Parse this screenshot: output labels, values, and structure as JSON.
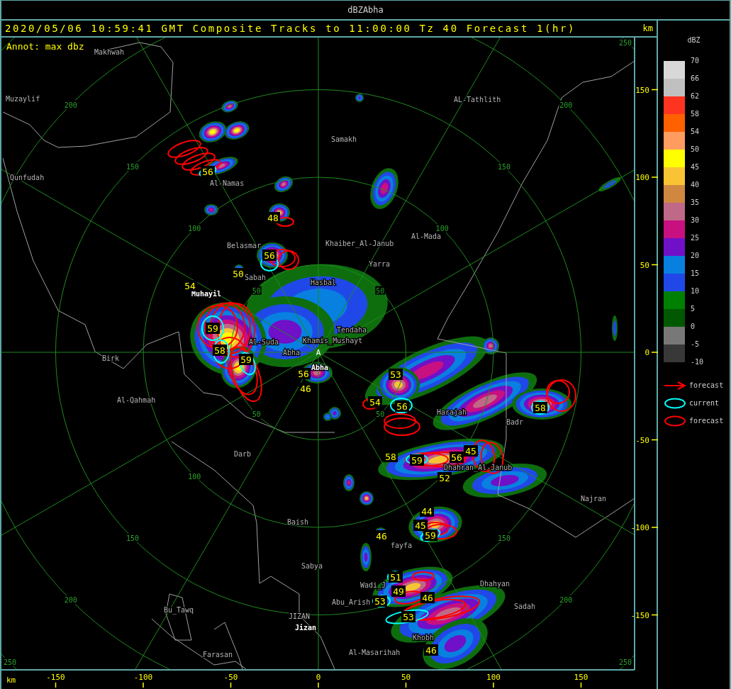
{
  "window": {
    "title": "dBZAbha"
  },
  "header": {
    "title": "2020/05/06 10:59:41 GMT Composite Tracks to 11:00:00 Tz 40 Forecast 1(hr)",
    "units": "km",
    "annotation": "Annot: max dbz"
  },
  "map": {
    "radar_marker": "A",
    "places": [
      {
        "name": "Makhwah",
        "kind": "plain"
      },
      {
        "name": "Muzaylif",
        "kind": "plain"
      },
      {
        "name": "AL-Tathlith",
        "kind": "plain"
      },
      {
        "name": "Samakh",
        "kind": "plain"
      },
      {
        "name": "Qunfudah",
        "kind": "plain"
      },
      {
        "name": "Al-Namas",
        "kind": "plain"
      },
      {
        "name": "Al-Mada",
        "kind": "plain"
      },
      {
        "name": "Belasmar",
        "kind": "plain"
      },
      {
        "name": "Khaiber_Al-Janub",
        "kind": "plain"
      },
      {
        "name": "Yarra",
        "kind": "plain"
      },
      {
        "name": "Sabah",
        "kind": "plain"
      },
      {
        "name": "Hasbal",
        "kind": "plain"
      },
      {
        "name": "Muhayil",
        "kind": "bright"
      },
      {
        "name": "Tendaha",
        "kind": "plain"
      },
      {
        "name": "Al-Suda",
        "kind": "plain"
      },
      {
        "name": "Khamis_Mushayt",
        "kind": "plain"
      },
      {
        "name": "Birk",
        "kind": "plain"
      },
      {
        "name": "Abha",
        "kind": "plain"
      },
      {
        "name": "Abha",
        "kind": "bright"
      },
      {
        "name": "Al-Qahmah",
        "kind": "plain"
      },
      {
        "name": "Harajah",
        "kind": "plain"
      },
      {
        "name": "Badr",
        "kind": "plain"
      },
      {
        "name": "Darb",
        "kind": "plain"
      },
      {
        "name": "Dhahran_Al-Janub",
        "kind": "plain"
      },
      {
        "name": "Najran",
        "kind": "plain"
      },
      {
        "name": "Baish",
        "kind": "plain"
      },
      {
        "name": "fayfa",
        "kind": "plain"
      },
      {
        "name": "Sabya",
        "kind": "plain"
      },
      {
        "name": "Wadi_J",
        "kind": "plain"
      },
      {
        "name": "Dhahyan",
        "kind": "plain"
      },
      {
        "name": "Abu_Arish",
        "kind": "plain"
      },
      {
        "name": "Sadah",
        "kind": "plain"
      },
      {
        "name": "Bu_Tawq",
        "kind": "plain"
      },
      {
        "name": "JIZAN",
        "kind": "plain"
      },
      {
        "name": "Jizan",
        "kind": "bright"
      },
      {
        "name": "Khobh",
        "kind": "plain"
      },
      {
        "name": "Al-Masarihah",
        "kind": "plain"
      },
      {
        "name": "Farasan",
        "kind": "plain"
      }
    ],
    "ring_labels": [
      {
        "text": "250"
      },
      {
        "text": "200"
      },
      {
        "text": "200"
      },
      {
        "text": "150"
      },
      {
        "text": "150"
      },
      {
        "text": "100"
      },
      {
        "text": "100"
      },
      {
        "text": "50"
      },
      {
        "text": "50"
      },
      {
        "text": "50"
      },
      {
        "text": "50"
      },
      {
        "text": "100"
      },
      {
        "text": "150"
      },
      {
        "text": "150"
      },
      {
        "text": "200"
      },
      {
        "text": "200"
      },
      {
        "text": "250"
      },
      {
        "text": "250"
      }
    ],
    "max_dbz_labels": [
      {
        "text": "56"
      },
      {
        "text": "48"
      },
      {
        "text": "56"
      },
      {
        "text": "50"
      },
      {
        "text": "54"
      },
      {
        "text": "59"
      },
      {
        "text": "58"
      },
      {
        "text": "59"
      },
      {
        "text": "56"
      },
      {
        "text": "46"
      },
      {
        "text": "53"
      },
      {
        "text": "54"
      },
      {
        "text": "56"
      },
      {
        "text": "58"
      },
      {
        "text": "58"
      },
      {
        "text": "59"
      },
      {
        "text": "45"
      },
      {
        "text": "56"
      },
      {
        "text": "52"
      },
      {
        "text": "44"
      },
      {
        "text": "45"
      },
      {
        "text": "59"
      },
      {
        "text": "46"
      },
      {
        "text": "51"
      },
      {
        "text": "49"
      },
      {
        "text": "46"
      },
      {
        "text": "53"
      },
      {
        "text": "53"
      },
      {
        "text": "46"
      }
    ]
  },
  "y_axis": {
    "ticks": [
      "150",
      "100",
      "50",
      "0",
      "-50",
      "-100",
      "-150"
    ]
  },
  "x_axis": {
    "unit": "km",
    "ticks": [
      "-150",
      "-100",
      "-50",
      "0",
      "50",
      "100",
      "150"
    ]
  },
  "legend": {
    "title": "dBZ",
    "scale_labels": [
      "70",
      "66",
      "62",
      "58",
      "54",
      "50",
      "45",
      "40",
      "35",
      "30",
      "25",
      "20",
      "15",
      "10",
      "5",
      "0",
      "-5",
      "-10"
    ],
    "swatches": [
      {
        "color": "#d8d8d8"
      },
      {
        "color": "#c0c0c0"
      },
      {
        "color": "#ff3420"
      },
      {
        "color": "#ff6000"
      },
      {
        "color": "#ff9c60"
      },
      {
        "color": "#ffff00"
      },
      {
        "color": "#f8c434"
      },
      {
        "color": "#d08840"
      },
      {
        "color": "#c06888"
      },
      {
        "color": "#c81080"
      },
      {
        "color": "#7010c8"
      },
      {
        "color": "#0880e0"
      },
      {
        "color": "#2048e8"
      },
      {
        "color": "#008000"
      },
      {
        "color": "#005800"
      },
      {
        "color": "#787878"
      },
      {
        "color": "#383838"
      }
    ],
    "symbols": [
      {
        "kind": "arrow",
        "label": "forecast"
      },
      {
        "kind": "current",
        "label": "current"
      },
      {
        "kind": "forecast",
        "label": "forecast"
      }
    ]
  }
}
